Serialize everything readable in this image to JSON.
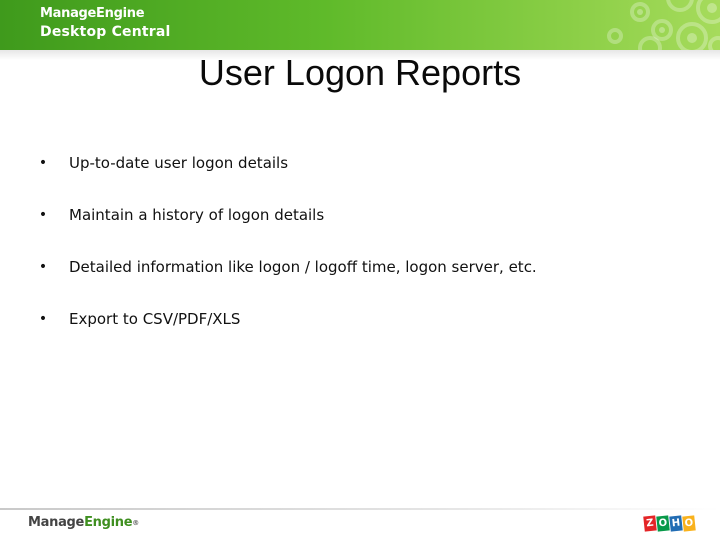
{
  "header": {
    "brand": "ManageEngine",
    "product": "Desktop Central"
  },
  "slide": {
    "title": "User Logon Reports",
    "bullet_glyph": "•",
    "bullets": [
      "Up-to-date user logon details",
      "Maintain a history of logon details",
      "Detailed information like logon / logoff time, logon server, etc.",
      "Export to CSV/PDF/XLS"
    ]
  },
  "footer": {
    "brand_part1": "Manage",
    "brand_part2": "Engine",
    "registered_mark": "®",
    "zoho_letters": [
      "Z",
      "O",
      "H",
      "O"
    ]
  },
  "colors": {
    "header_green": "#5fba2a",
    "zoho": [
      "#e42527",
      "#089949",
      "#226db4",
      "#f9b21d"
    ]
  }
}
